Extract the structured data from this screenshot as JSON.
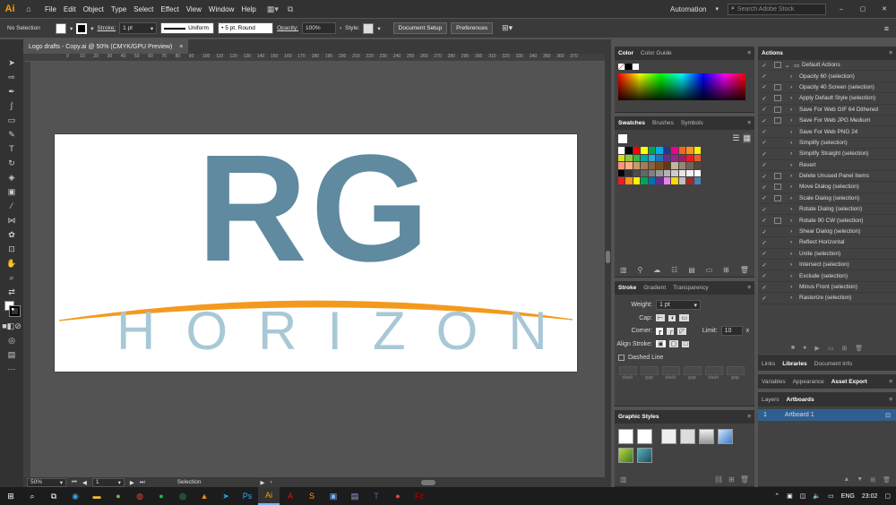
{
  "app": {
    "logo": "Ai",
    "workspace": "Automation",
    "search_placeholder": "Search Adobe Stock"
  },
  "menu": [
    "File",
    "Edit",
    "Object",
    "Type",
    "Select",
    "Effect",
    "View",
    "Window",
    "Help"
  ],
  "control": {
    "selection": "No Selection",
    "stroke_label": "Stroke:",
    "stroke_weight": "1 pt",
    "profile": "Uniform",
    "brush": "5 pt. Round",
    "opacity_label": "Opacity:",
    "opacity": "100%",
    "style_label": "Style:",
    "doc_setup": "Document Setup",
    "preferences": "Preferences"
  },
  "document": {
    "tab": "Logo drafts - Copy.ai @ 50% (CMYK/GPU Preview)",
    "close": "×",
    "zoom": "50%",
    "artboard_num": "1",
    "status": "Selection"
  },
  "ruler_ticks": [
    "0",
    "10",
    "20",
    "30",
    "40",
    "50",
    "60",
    "70",
    "80",
    "90",
    "100",
    "110",
    "120",
    "130",
    "140",
    "150",
    "160",
    "170",
    "180",
    "190",
    "200",
    "210",
    "220",
    "230",
    "240",
    "250",
    "260",
    "270",
    "280",
    "290",
    "300",
    "310",
    "320",
    "330",
    "340",
    "350",
    "360",
    "370"
  ],
  "artwork": {
    "main": "RG",
    "sub": "HORIZON",
    "main_color": "#5f8aa0",
    "sub_color": "#a8c8d6",
    "swoosh_color": "#f39a1e"
  },
  "color_panel": {
    "tabs": [
      "Color",
      "Color Guide"
    ]
  },
  "swatches_panel": {
    "tabs": [
      "Swatches",
      "Brushes",
      "Symbols"
    ],
    "rows": [
      [
        "#ffffff",
        "#000000",
        "#ff0000",
        "#ffff00",
        "#00a651",
        "#00aeef",
        "#2e3192",
        "#ec008c",
        "#f26522",
        "#f7941d",
        "#fff200"
      ],
      [
        "#d7df23",
        "#8dc63f",
        "#39b54a",
        "#00a99d",
        "#27aae1",
        "#1c75bc",
        "#662d91",
        "#92278f",
        "#9e1f63",
        "#ed1c24",
        "#f15a24"
      ],
      [
        "#f7977a",
        "#fbad82",
        "#c69c6d",
        "#a67c52",
        "#8c6239",
        "#754c24",
        "#603913",
        "#c2b59b",
        "#998675",
        "#736357",
        "#534741"
      ],
      [
        "#000000",
        "#333333",
        "#4d4d4d",
        "#666666",
        "#808080",
        "#999999",
        "#b3b3b3",
        "#cccccc",
        "#e6e6e6",
        "#f2f2f2",
        "#ffffff"
      ],
      [
        "#ed1c24",
        "#f7941d",
        "#fff200",
        "#00a651",
        "#0072bc",
        "#662d91",
        "#ee82ee",
        "#ffd700",
        "#c0c0c0",
        "#a52a2a",
        "#4682b4"
      ]
    ]
  },
  "stroke_panel": {
    "tabs": [
      "Stroke",
      "Gradient",
      "Transparency"
    ],
    "weight_label": "Weight:",
    "weight": "1 pt",
    "cap_label": "Cap:",
    "corner_label": "Corner:",
    "limit_label": "Limit:",
    "limit": "10",
    "limit_unit": "x",
    "align_label": "Align Stroke:",
    "dashed": "Dashed Line",
    "dash_labels": [
      "dash",
      "gap",
      "dash",
      "gap",
      "dash",
      "gap"
    ]
  },
  "graphic_styles": {
    "title": "Graphic Styles"
  },
  "actions_panel": {
    "title": "Actions",
    "set": "Default Actions",
    "items": [
      "Opacity 60 (selection)",
      "Opacity 40 Screen (selection)",
      "Apply Default Style (selection)",
      "Save For Web GIF 64 Dithered",
      "Save For Web JPG Medium",
      "Save For Web PNG 24",
      "Simplify (selection)",
      "Simplify Straight (selection)",
      "Revert",
      "Delete Unused Panel Items",
      "Move Dialog (selection)",
      "Scale Dialog (selection)",
      "Rotate Dialog (selection)",
      "Rotate 90 CW (selection)",
      "Shear Dialog (selection)",
      "Reflect Horizontal",
      "Unite (selection)",
      "Intersect (selection)",
      "Exclude (selection)",
      "Minus Front (selection)",
      "Rasterize (selection)"
    ]
  },
  "lower_tabs1": [
    "Links",
    "Libraries",
    "Document Info"
  ],
  "lower_tabs2": [
    "Variables",
    "Appearance",
    "Asset Export"
  ],
  "artboards_panel": {
    "tabs": [
      "Layers",
      "Artboards"
    ],
    "row_num": "1",
    "row_name": "Artboard 1"
  },
  "taskbar": {
    "lang": "ENG",
    "time": "23:02"
  }
}
